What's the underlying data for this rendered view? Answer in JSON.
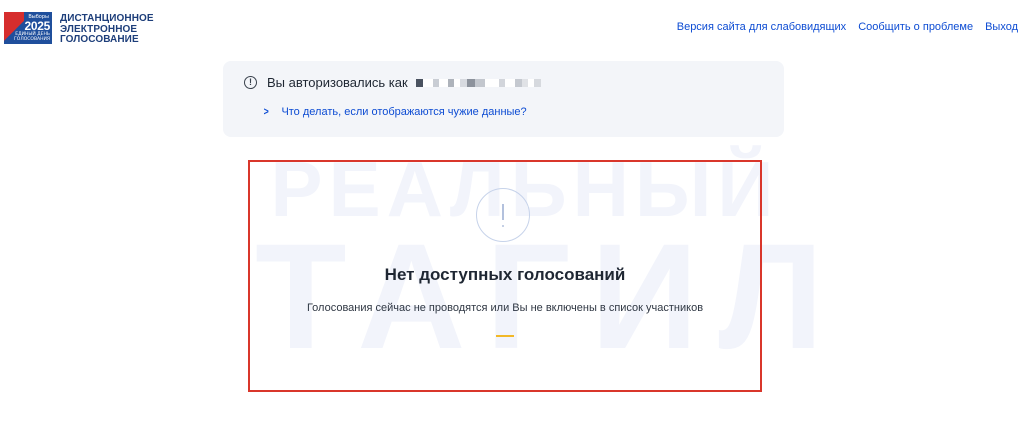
{
  "logo": {
    "badge_small": "Выборы",
    "year": "2025",
    "badge_line1": "ЕДИНЫЙ ДЕНЬ",
    "badge_line2": "ГОЛОСОВАНИЯ",
    "title_lines": [
      "ДИСТАНЦИОННОЕ",
      "ЭЛЕКТРОННОЕ",
      "ГОЛОСОВАНИЕ"
    ]
  },
  "nav": {
    "accessible_version": "Версия сайта для слабовидящих",
    "report_problem": "Сообщить о проблеме",
    "logout": "Выход"
  },
  "auth": {
    "label": "Вы авторизовались как",
    "help_link": "Что делать, если отображаются чужие данные?"
  },
  "watermark": {
    "line1": "РЕАЛЬНЫЙ",
    "line2": "ТАГИЛ"
  },
  "card": {
    "title": "Нет доступных голосований",
    "subtitle": "Голосования сейчас не проводятся или Вы не включены в список участников"
  },
  "colors": {
    "link": "#0d4cd3",
    "card_border": "#d9362b",
    "accent": "#f2b827",
    "panel_bg": "#f3f5f9"
  }
}
